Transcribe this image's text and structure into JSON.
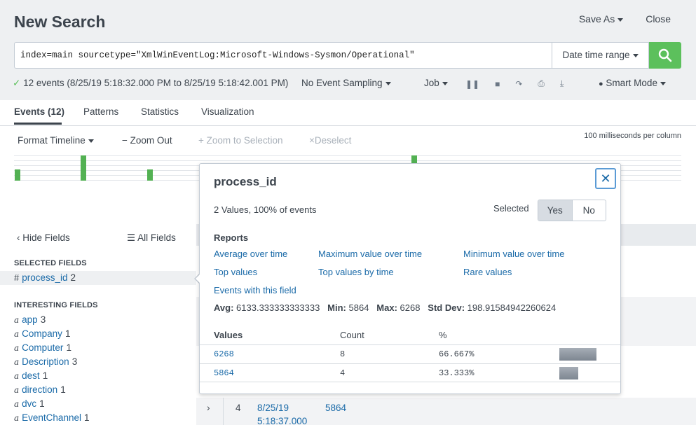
{
  "header": {
    "title": "New Search",
    "save_as": "Save As",
    "close": "Close"
  },
  "search": {
    "query": "index=main sourcetype=\"XmlWinEventLog:Microsoft-Windows-Sysmon/Operational\"",
    "date_range": "Date time range"
  },
  "status": {
    "summary": "12 events (8/25/19 5:18:32.000 PM to 8/25/19 5:18:42.001 PM)",
    "sampling": "No Event Sampling",
    "job": "Job",
    "mode": "Smart Mode"
  },
  "tabs": [
    {
      "label": "Events (12)"
    },
    {
      "label": "Patterns"
    },
    {
      "label": "Statistics"
    },
    {
      "label": "Visualization"
    }
  ],
  "timeline": {
    "format": "Format Timeline",
    "zoom_out": "Zoom Out",
    "zoom_selection": "Zoom to Selection",
    "deselect": "Deselect",
    "scale": "100 milliseconds per column",
    "bar_levels": [
      0.45,
      1.0,
      0.45,
      0.3,
      1.0
    ]
  },
  "sidebar": {
    "hide_fields": "Hide Fields",
    "all_fields": "All Fields",
    "selected_heading": "SELECTED FIELDS",
    "selected_fields": [
      {
        "type": "#",
        "name": "process_id",
        "count": "2"
      }
    ],
    "interesting_heading": "INTERESTING FIELDS",
    "interesting_fields": [
      {
        "type": "a",
        "name": "app",
        "count": "3"
      },
      {
        "type": "a",
        "name": "Company",
        "count": "1"
      },
      {
        "type": "a",
        "name": "Computer",
        "count": "1"
      },
      {
        "type": "a",
        "name": "Description",
        "count": "3"
      },
      {
        "type": "a",
        "name": "dest",
        "count": "1"
      },
      {
        "type": "a",
        "name": "direction",
        "count": "1"
      },
      {
        "type": "a",
        "name": "dvc",
        "count": "1"
      },
      {
        "type": "a",
        "name": "EventChannel",
        "count": "1"
      }
    ]
  },
  "event_row": {
    "index": "4",
    "time_line1": "8/25/19",
    "time_line2": "5:18:37.000",
    "value": "5864"
  },
  "popover": {
    "title": "process_id",
    "summary": "2 Values, 100% of events",
    "selected_label": "Selected",
    "yes": "Yes",
    "no": "No",
    "reports_label": "Reports",
    "reports": [
      "Average over time",
      "Maximum value over time",
      "Minimum value over time",
      "Top values",
      "Top values by time",
      "Rare values",
      "Events with this field"
    ],
    "stats": {
      "avg_label": "Avg:",
      "avg": "6133.333333333333",
      "min_label": "Min:",
      "min": "5864",
      "max_label": "Max:",
      "max": "6268",
      "std_label": "Std Dev:",
      "std": "198.91584942260624"
    },
    "table_headers": {
      "values": "Values",
      "count": "Count",
      "percent": "%"
    },
    "rows": [
      {
        "value": "6268",
        "count": "8",
        "percent": "66.667%",
        "fraction": 0.66667
      },
      {
        "value": "5864",
        "count": "4",
        "percent": "33.333%",
        "fraction": 0.33333
      }
    ]
  }
}
